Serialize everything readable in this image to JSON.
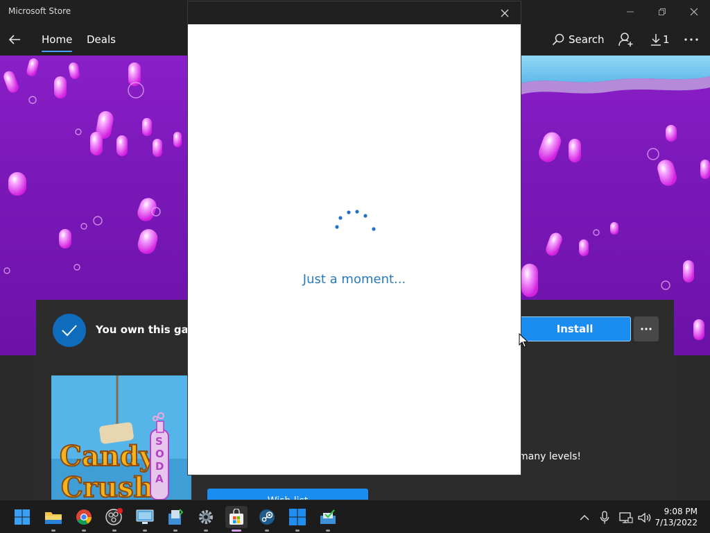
{
  "window": {
    "title": "Microsoft Store"
  },
  "nav": {
    "tabs": [
      {
        "label": "Home"
      },
      {
        "label": "Deals"
      }
    ],
    "search_label": "Search",
    "downloads_count": "1"
  },
  "product": {
    "ownership": "You own this game.",
    "install_label": "Install",
    "description_fragment": "many levels!",
    "wishlist_label": "Wish list",
    "thumbnail_title": "Candy Crush Soda"
  },
  "dialog": {
    "message": "Just a moment..."
  },
  "taskbar": {
    "time": "9:08 PM",
    "date": "7/13/2022"
  },
  "colors": {
    "accent": "#1b8cf0",
    "check_circle": "#0f6cbd",
    "loading_text": "#2a7ab8",
    "hero_purple": "#7a18b8"
  }
}
